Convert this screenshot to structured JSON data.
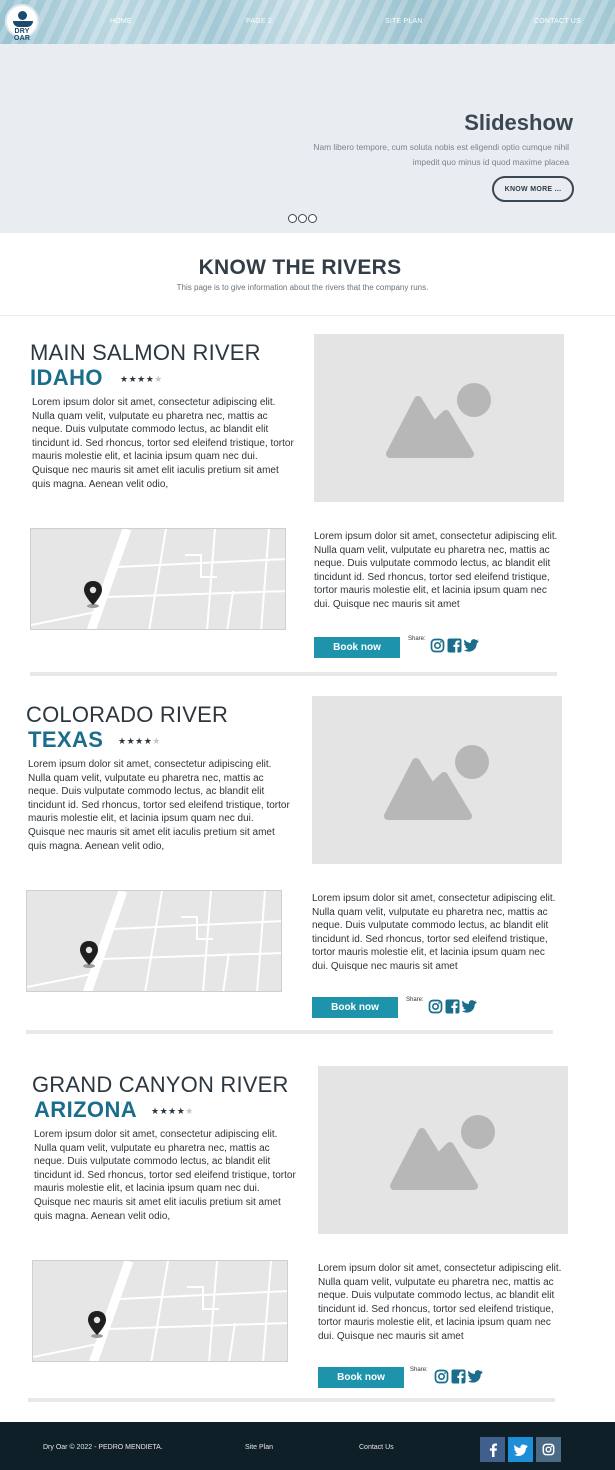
{
  "nav": {
    "logo_text": "DRY OAR",
    "links": [
      "HOME",
      "PAGE 2",
      "SITE PLAN",
      "CONTACT US"
    ]
  },
  "hero": {
    "title": "Slideshow",
    "text": "Nam libero tempore, cum soluta nobis est eligendi optio cumque nihil impedit quo minus id quod maxime placea",
    "button": "KNOW MORE ...",
    "slide_count": 3
  },
  "intro": {
    "title": "KNOW THE RIVERS",
    "subtitle": "This page is to give information about the rivers that the company runs."
  },
  "rivers": [
    {
      "name": "MAIN SALMON RIVER",
      "state": "IDAHO",
      "stars": "★★★★",
      "stars_off": "★",
      "description": "Lorem ipsum dolor sit amet, consectetur adipiscing elit. Nulla quam velit, vulputate eu pharetra nec, mattis ac neque. Duis vulputate commodo lectus, ac blandit elit tincidunt id. Sed rhoncus, tortor sed eleifend tristique, tortor mauris molestie elit, et lacinia ipsum quam nec dui. Quisque nec mauris sit amet elit iaculis pretium sit amet quis magna. Aenean velit odio,",
      "description2": "Lorem ipsum dolor sit amet, consectetur adipiscing elit. Nulla quam velit, vulputate eu pharetra nec, mattis ac neque. Duis vulputate commodo lectus, ac blandit elit tincidunt id. Sed rhoncus, tortor sed eleifend tristique, tortor mauris molestie elit, et lacinia ipsum quam nec dui. Quisque nec mauris sit amet",
      "book_label": "Book now",
      "share_label": "Share:"
    },
    {
      "name": "COLORADO RIVER",
      "state": "TEXAS",
      "stars": "★★★★",
      "stars_off": "★",
      "description": "Lorem ipsum dolor sit amet, consectetur adipiscing elit. Nulla quam velit, vulputate eu pharetra nec, mattis ac neque. Duis vulputate commodo lectus, ac blandit elit tincidunt id. Sed rhoncus, tortor sed eleifend tristique, tortor mauris molestie elit, et lacinia ipsum quam nec dui. Quisque nec mauris sit amet elit iaculis pretium sit amet quis magna. Aenean velit odio,",
      "description2": "Lorem ipsum dolor sit amet, consectetur adipiscing elit. Nulla quam velit, vulputate eu pharetra nec, mattis ac neque. Duis vulputate commodo lectus, ac blandit elit tincidunt id. Sed rhoncus, tortor sed eleifend tristique, tortor mauris molestie elit, et lacinia ipsum quam nec dui. Quisque nec mauris sit amet",
      "book_label": "Book now",
      "share_label": "Share:"
    },
    {
      "name": "GRAND CANYON RIVER",
      "state": "ARIZONA",
      "stars": "★★★★",
      "stars_off": "★",
      "description": "Lorem ipsum dolor sit amet, consectetur adipiscing elit. Nulla quam velit, vulputate eu pharetra nec, mattis ac neque. Duis vulputate commodo lectus, ac blandit elit tincidunt id. Sed rhoncus, tortor sed eleifend tristique, tortor mauris molestie elit, et lacinia ipsum quam nec dui. Quisque nec mauris sit amet elit iaculis pretium sit amet quis magna. Aenean velit odio,",
      "description2": "Lorem ipsum dolor sit amet, consectetur adipiscing elit. Nulla quam velit, vulputate eu pharetra nec, mattis ac neque. Duis vulputate commodo lectus, ac blandit elit tincidunt id. Sed rhoncus, tortor sed eleifend tristique, tortor mauris molestie elit, et lacinia ipsum quam nec dui. Quisque nec mauris sit amet",
      "book_label": "Book now",
      "share_label": "Share:"
    }
  ],
  "share_icons": [
    "instagram-icon",
    "facebook-icon",
    "twitter-icon"
  ],
  "footer": {
    "copyright": "Dry Oar © 2022 - PEDRO MENDIETA.",
    "site_plan": "Site Plan",
    "contact": "Contact Us",
    "social": [
      "facebook-icon",
      "twitter-icon",
      "instagram-icon"
    ]
  },
  "colors": {
    "accent": "#1a6e8c",
    "button": "#1d94ac",
    "footer_bg": "#0f1f28",
    "social_bg": "#3f5f8c"
  }
}
